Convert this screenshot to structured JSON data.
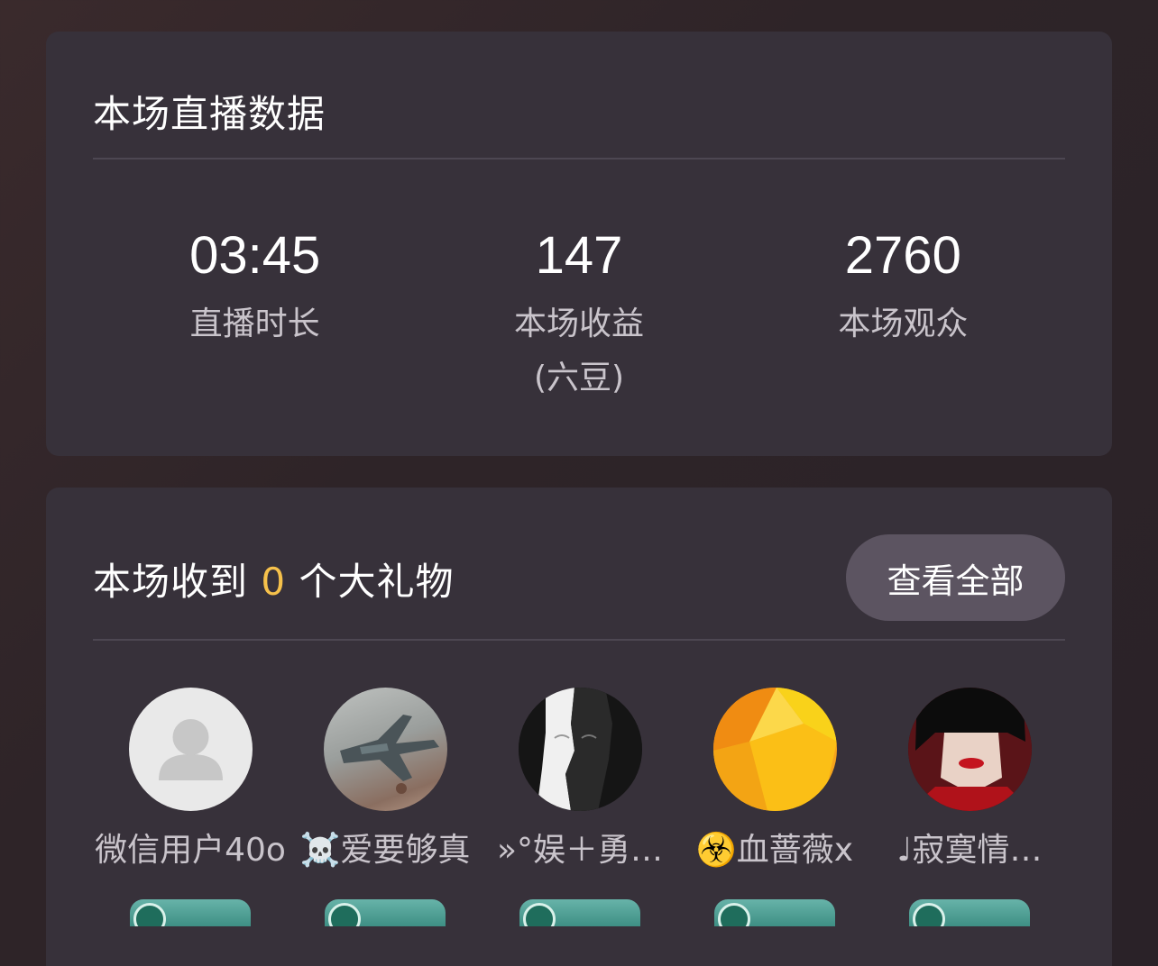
{
  "stats_card": {
    "title": "本场直播数据",
    "stats": [
      {
        "value": "03:45",
        "label": "直播时长"
      },
      {
        "value": "147",
        "label": "本场收益\n(六豆)"
      },
      {
        "value": "2760",
        "label": "本场观众"
      }
    ]
  },
  "gifts_card": {
    "title_prefix": "本场收到 ",
    "count": "0",
    "title_suffix": " 个大礼物",
    "view_all_label": "查看全部",
    "users": [
      {
        "name": "微信用户40o",
        "avatar": "default-person-icon"
      },
      {
        "name": "☠️爱要够真",
        "avatar": "fighter-jet-photo"
      },
      {
        "name": "»°娱＋勇…",
        "avatar": "black-white-face-photo"
      },
      {
        "name": "☣️血蔷薇x",
        "avatar": "orange-geometric-photo"
      },
      {
        "name": "♩寂寞情…",
        "avatar": "red-lips-woman-photo"
      }
    ]
  },
  "colors": {
    "card_background": "#37313a",
    "accent_count": "#f6c14b",
    "button_background": "#5c5461",
    "badge_teal": "#4fa195"
  }
}
